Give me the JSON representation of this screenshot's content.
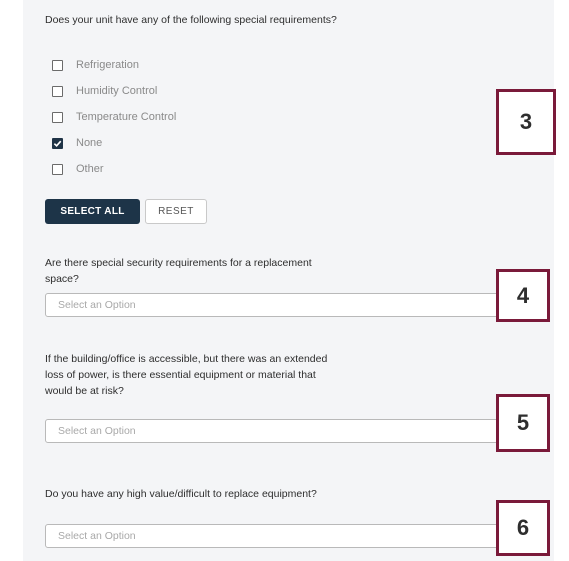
{
  "q1": {
    "question": "Does your unit have any of the following special requirements?",
    "options": [
      {
        "label": "Refrigeration",
        "checked": false
      },
      {
        "label": "Humidity Control",
        "checked": false
      },
      {
        "label": "Temperature Control",
        "checked": false
      },
      {
        "label": "None",
        "checked": true
      },
      {
        "label": "Other",
        "checked": false
      }
    ],
    "select_all_label": "SELECT ALL",
    "reset_label": "RESET"
  },
  "q2": {
    "question": "Are there special security requirements for a replacement space?",
    "placeholder": "Select an Option"
  },
  "q3": {
    "question": "If the building/office is accessible, but there was an extended loss of power, is there essential equipment or material that would be at risk?",
    "placeholder": "Select an Option"
  },
  "q4": {
    "question": "Do you have any high value/difficult to replace equipment?",
    "placeholder": "Select an Option"
  },
  "markers": [
    "3",
    "4",
    "5",
    "6"
  ],
  "colors": {
    "marker_border": "#7a1a3a",
    "primary_button": "#1d3448",
    "panel_background": "#f4f5f7"
  }
}
